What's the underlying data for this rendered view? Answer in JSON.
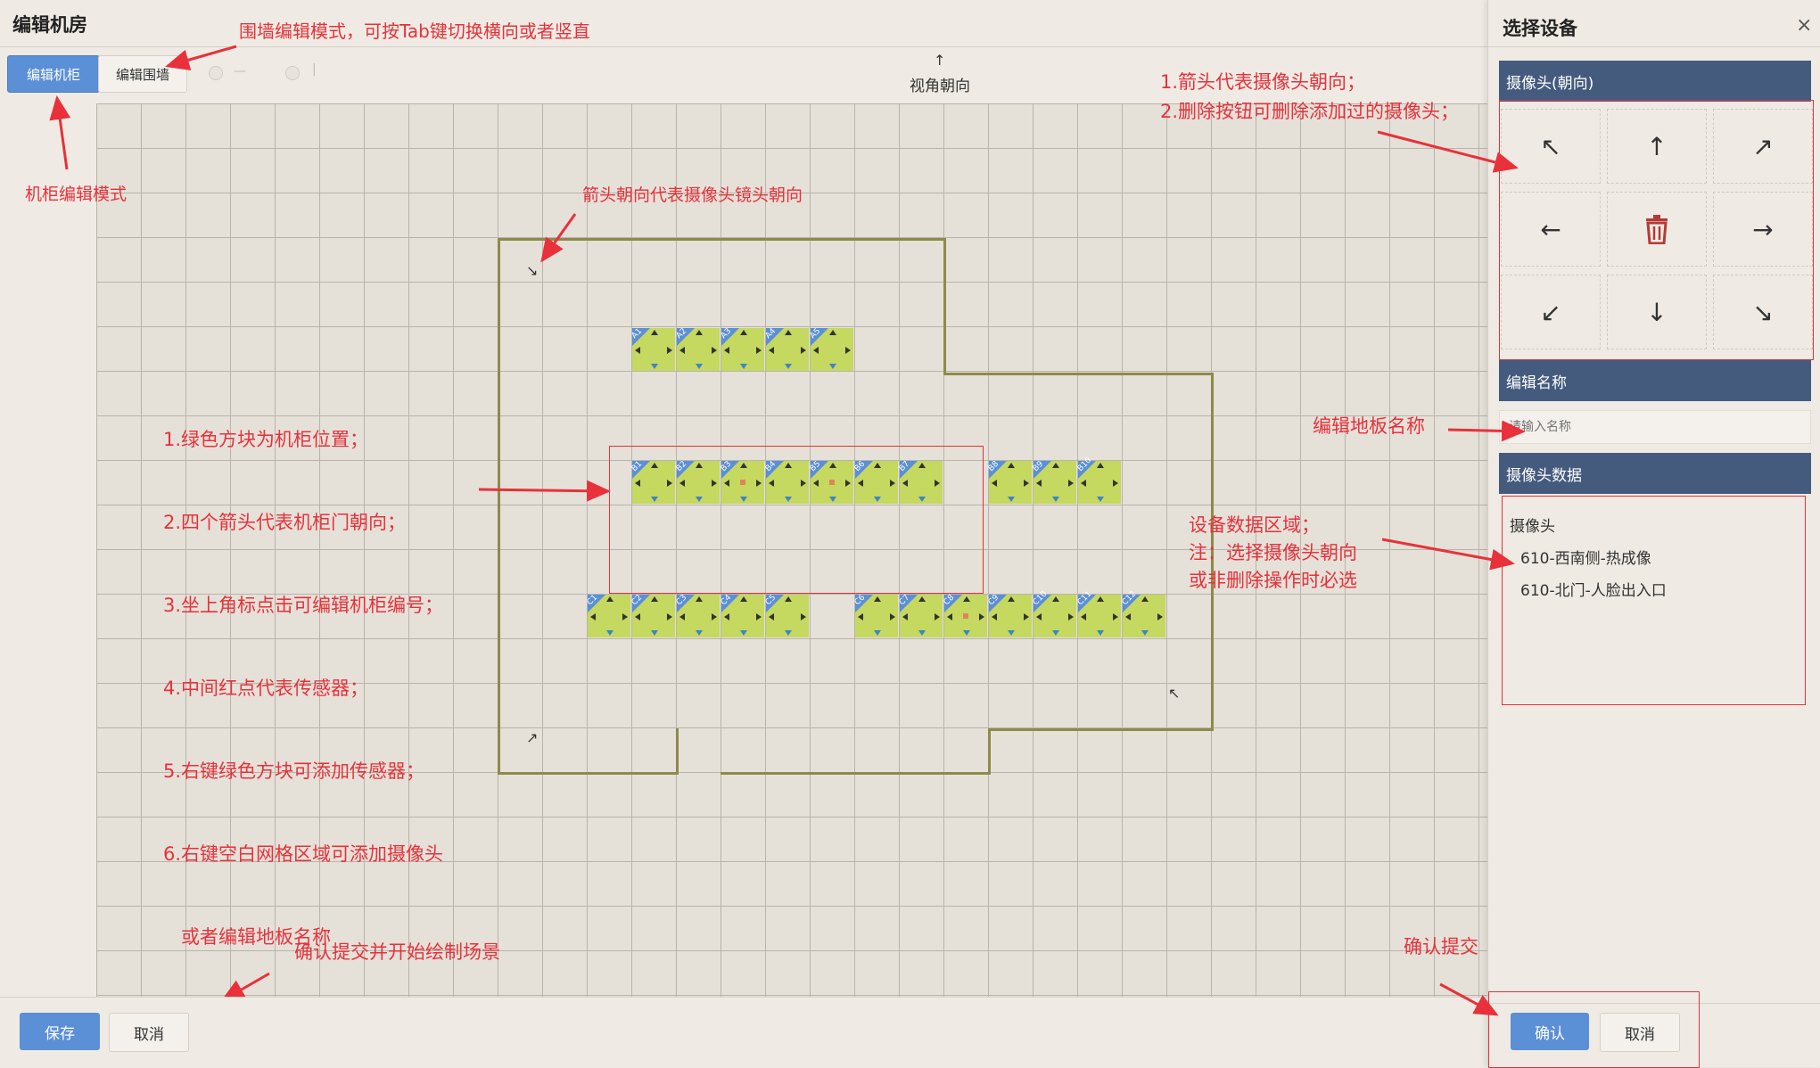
{
  "window": {
    "title": "编辑机房"
  },
  "toolbar": {
    "edit_cabinet": "编辑机柜",
    "edit_wall": "编辑围墙",
    "hint_dash": "—",
    "hint_bar": "|"
  },
  "view": {
    "arrow": "↑",
    "label": "视角朝向"
  },
  "cabinet_rows": {
    "row_a": [
      "A1",
      "A2",
      "A3",
      "A4",
      "A5"
    ],
    "row_b": [
      "B1",
      "B2",
      "B3",
      "B4",
      "B5",
      "B6",
      "B7",
      "B8",
      "B9",
      "B10"
    ],
    "row_c": [
      "C1",
      "C2",
      "C3",
      "C4",
      "C5",
      "C6",
      "C7",
      "C8",
      "C9",
      "C10",
      "C11",
      "C12"
    ]
  },
  "camera_markers": [
    "↘",
    "↖",
    "↗"
  ],
  "annotations": {
    "wall_mode": "围墙编辑模式，可按Tab键切换横向或者竖直",
    "cabinet_mode": "机柜编辑模式",
    "camera_dir": "箭头朝向代表摄像头镜头朝向",
    "legend": [
      "1.绿色方块为机柜位置；",
      "2.四个箭头代表机柜门朝向；",
      "3.坐上角标点击可编辑机柜编号；",
      "4.中间红点代表传感器；",
      "5.右键绿色方块可添加传感器；",
      "6.右键空白网格区域可添加摄像头",
      "   或者编辑地板名称"
    ],
    "panel_arrows": [
      "1.箭头代表摄像头朝向；",
      "2.删除按钮可删除添加过的摄像头；"
    ],
    "floor_name": "编辑地板名称",
    "device_data": [
      "设备数据区域；",
      "注：选择摄像头朝向",
      "或非删除操作时必选"
    ],
    "confirm_draw": "确认提交并开始绘制场景",
    "confirm_submit": "确认提交"
  },
  "footer": {
    "save": "保存",
    "cancel": "取消"
  },
  "panel": {
    "title": "选择设备",
    "close": "×",
    "camera_dir_header": "摄像头(朝向)",
    "directions": [
      "↖",
      "↑",
      "↗",
      "←",
      "trash",
      "→",
      "↙",
      "↓",
      "↘"
    ],
    "edit_name_header": "编辑名称",
    "name_placeholder": "请输入名称",
    "camera_data_header": "摄像头数据",
    "camera_group": "摄像头",
    "cameras": [
      "610-西南侧-热成像",
      "610-北门-人脸出入口"
    ],
    "confirm": "确认",
    "cancel": "取消"
  },
  "colors": {
    "accent": "#5b8fd6",
    "cabinet": "#c5d85f",
    "wall": "#8e8a4a",
    "annotation": "#e8313a",
    "section_header": "#445b7e"
  }
}
